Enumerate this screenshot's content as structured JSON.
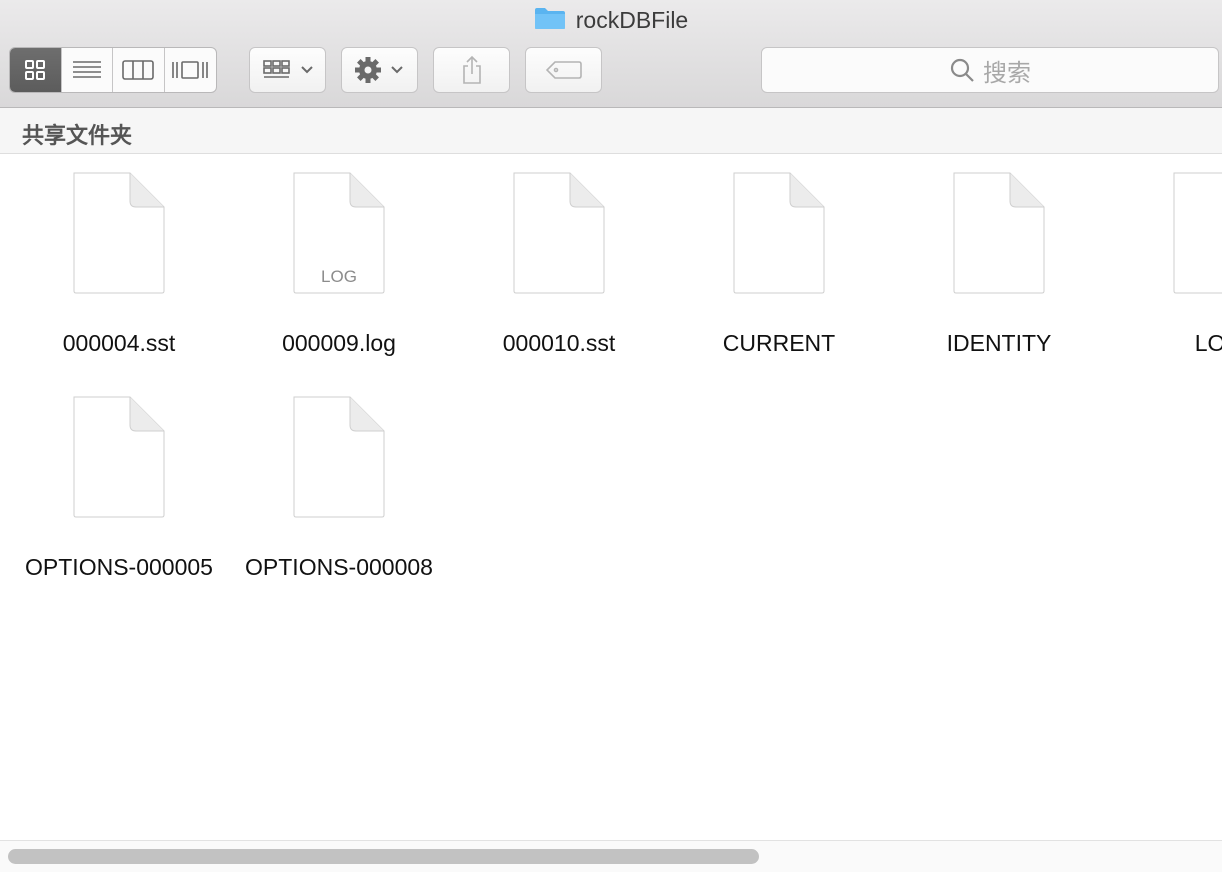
{
  "window": {
    "title": "rockDBFile"
  },
  "toolbar": {
    "view_modes": [
      "icon-view",
      "list-view",
      "column-view",
      "cover-flow-view"
    ],
    "active_view": "icon-view",
    "arrange_icon": "grid-arrange-icon",
    "action_icon": "gear-icon",
    "share_icon": "share-icon",
    "tag_icon": "tag-icon",
    "search_placeholder": "搜索"
  },
  "pathbar": {
    "label": "共享文件夹"
  },
  "files": [
    {
      "name": "000004.sst",
      "badge": ""
    },
    {
      "name": "000009.log",
      "badge": "LOG"
    },
    {
      "name": "000010.sst",
      "badge": ""
    },
    {
      "name": "CURRENT",
      "badge": ""
    },
    {
      "name": "IDENTITY",
      "badge": ""
    },
    {
      "name": "LOG",
      "badge": ""
    },
    {
      "name": "OPTIONS-000005",
      "badge": ""
    },
    {
      "name": "OPTIONS-000008",
      "badge": ""
    }
  ],
  "colors": {
    "active_segment": "#626262",
    "folder_blue": "#5ab4f0"
  }
}
